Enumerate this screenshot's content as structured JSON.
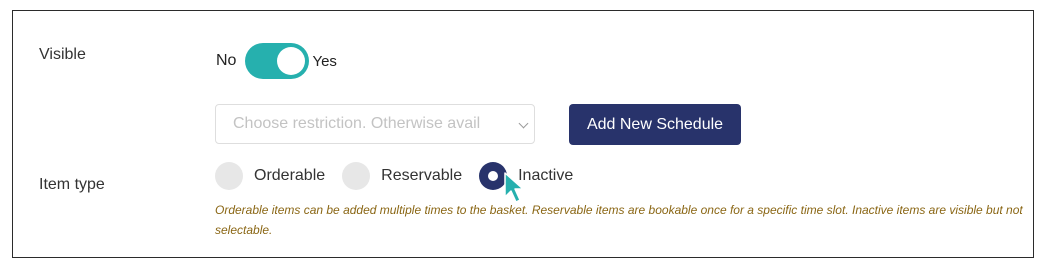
{
  "colors": {
    "toggle_on": "#26b0ae",
    "primary_button": "#28336b",
    "radio_checked": "#28336b",
    "help_text": "#8a6614",
    "cursor": "#26b0ae"
  },
  "visible": {
    "label": "Visible",
    "off_label": "No",
    "on_label": "Yes",
    "state": "on"
  },
  "schedule": {
    "select_placeholder": "Choose restriction. Otherwise avail",
    "add_button_label": "Add New Schedule"
  },
  "item_type": {
    "label": "Item type",
    "options": [
      {
        "label": "Orderable",
        "checked": false
      },
      {
        "label": "Reservable",
        "checked": false
      },
      {
        "label": "Inactive",
        "checked": true
      }
    ],
    "help_text": "Orderable items can be added multiple times to the basket. Reservable items are bookable once for a specific time slot. Inactive items are visible but not selectable."
  },
  "icons": {
    "cursor": "pointer-cursor-icon",
    "select_arrow": "chevron-down-icon"
  }
}
